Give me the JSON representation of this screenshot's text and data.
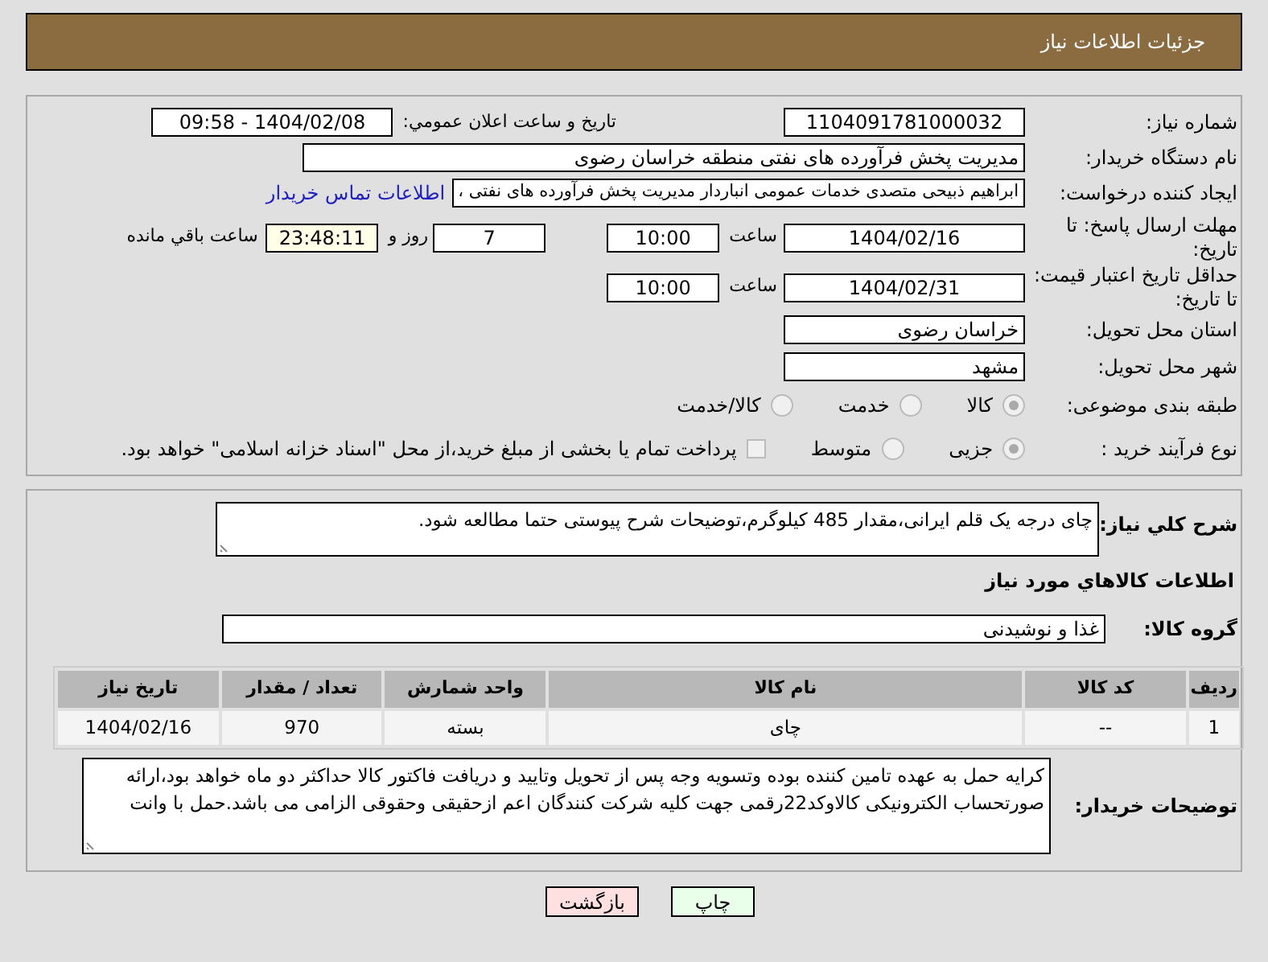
{
  "header": {
    "title": "جزئیات اطلاعات نیاز"
  },
  "need_number": {
    "label": "شماره نیاز:",
    "value": "1104091781000032"
  },
  "announce": {
    "label": "تاریخ و ساعت اعلان عمومي:",
    "value": "1404/02/08 - 09:58"
  },
  "buyer_org": {
    "label": "نام دستگاه خریدار:",
    "value": "مدیریت پخش فرآورده های نفتی منطقه خراسان رضوی"
  },
  "requester": {
    "label": "ایجاد کننده درخواست:",
    "value": "ابراهیم ذبیحی متصدی خدمات عمومی انباردار مدیریت پخش فرآورده های نفتی ،",
    "link": "اطلاعات تماس خریدار"
  },
  "deadline": {
    "label": "مهلت ارسال پاسخ: تا تاریخ:",
    "date": "1404/02/16",
    "time_label": "ساعت",
    "time": "10:00",
    "days": "7",
    "days_label": "روز و",
    "remaining": "23:48:11",
    "remaining_label": "ساعت باقي مانده"
  },
  "price_validity": {
    "label": "حداقل تاریخ اعتبار قیمت: تا تاریخ:",
    "date": "1404/02/31",
    "time_label": "ساعت",
    "time": "10:00"
  },
  "province": {
    "label": "استان محل تحویل:",
    "value": "خراسان رضوی"
  },
  "city": {
    "label": "شهر محل تحویل:",
    "value": "مشهد"
  },
  "category": {
    "label": "طبقه بندی موضوعی:",
    "options": [
      {
        "label": "کالا",
        "selected": true
      },
      {
        "label": "خدمت",
        "selected": false
      },
      {
        "label": "کالا/خدمت",
        "selected": false
      }
    ]
  },
  "process": {
    "label": "نوع فرآیند خرید :",
    "options": [
      {
        "label": "جزیی",
        "selected": true
      },
      {
        "label": "متوسط",
        "selected": false
      }
    ],
    "payment": {
      "label": "پرداخت تمام یا بخشی از مبلغ خرید،از محل \"اسناد خزانه اسلامی\" خواهد بود.",
      "checked": false
    }
  },
  "description": {
    "label": "شرح کلي نياز:",
    "text": "چای درجه یک قلم ایرانی،مقدار 485 کیلوگرم،توضیحات شرح پیوستی حتما مطالعه شود."
  },
  "goods": {
    "title": "اطلاعات کالاهاي مورد نياز",
    "group_label": "گروه کالا:",
    "group_value": "غذا و نوشیدنی",
    "table": {
      "columns": [
        "ردیف",
        "کد کالا",
        "نام کالا",
        "واحد شمارش",
        "تعداد / مقدار",
        "تاریخ نیاز"
      ],
      "rows": [
        [
          "1",
          "--",
          "چای",
          "بسته",
          "970",
          "1404/02/16"
        ]
      ]
    }
  },
  "buyer_notes": {
    "label": "توضیحات خریدار:",
    "text": "کرایه حمل به عهده تامین کننده بوده وتسویه وجه پس از تحویل وتایید و دریافت فاکتور کالا حداکثر دو ماه خواهد بود،ارائه صورتحساب الکترونیکی کالاوکد22رقمی جهت کلیه شرکت کنندگان اعم ازحقیقی وحقوقی الزامی می باشد.حمل با وانت"
  },
  "buttons": [
    {
      "label": "چاپ",
      "kind": "print"
    },
    {
      "label": "بازگشت",
      "kind": "back"
    }
  ]
}
